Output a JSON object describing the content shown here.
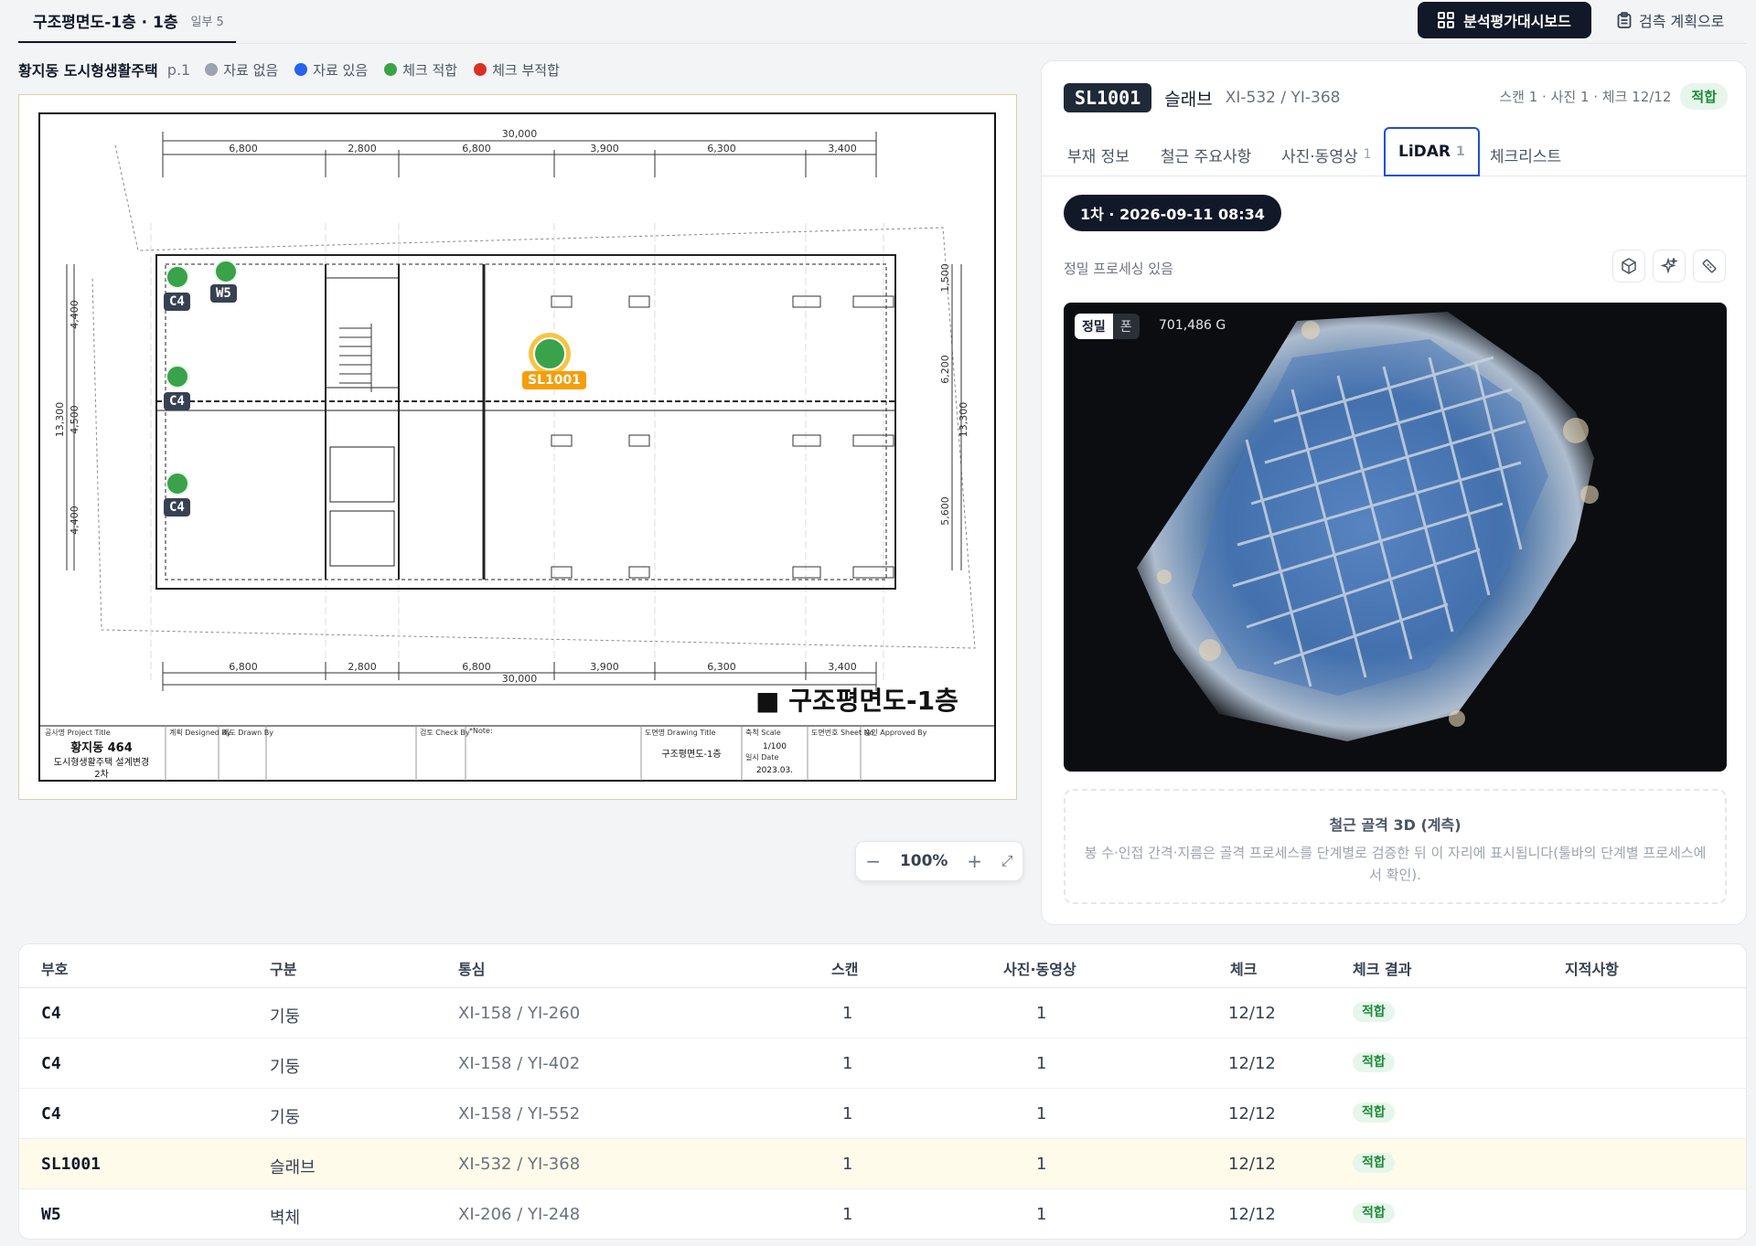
{
  "top": {
    "tab_title": "구조평면도-1층 · 1층",
    "tab_sub": "일부 5",
    "dashboard_label": "분석평가대시보드",
    "plan_label": "검측 계획으로"
  },
  "legend": {
    "project": "황지동 도시형생활주택",
    "page": "p.1",
    "items": [
      {
        "label": "자료 없음",
        "color": "#9ca3af"
      },
      {
        "label": "자료 있음",
        "color": "#2563eb"
      },
      {
        "label": "체크 적합",
        "color": "#3aa24a"
      },
      {
        "label": "체크 부적합",
        "color": "#d93025"
      }
    ]
  },
  "drawing": {
    "title": "■ 구조평면도-1층",
    "dims_top": [
      "6,800",
      "2,800",
      "6,800",
      "3,900",
      "6,300",
      "3,400"
    ],
    "dim_total": "30,000",
    "dims_left": [
      "4,400",
      "4,500",
      "4,400"
    ],
    "dim_left_total": "13,300",
    "dims_right": [
      "1,500",
      "6,200",
      "5,600"
    ],
    "dim_right_total": "13,300",
    "markers": [
      {
        "label": "C4"
      },
      {
        "label": "W5"
      },
      {
        "label": "C4"
      },
      {
        "label": "C4"
      },
      {
        "label": "SL1001"
      }
    ],
    "title_block": {
      "project_title_label": "공사명 Project Title",
      "project_name": "황지동 464",
      "project_sub": "도시형생활주택 설계변경",
      "project_rev": "2차",
      "designed_by": "계획 Designed By",
      "drawn_by": "제도 Drawn By",
      "check_by": "검토 Check By",
      "note": "*Note:",
      "drawing_title_label": "도면명 Drawing Title",
      "drawing_title": "구조평면도-1층",
      "scale_label": "축척 Scale",
      "scale": "1/100",
      "date_label": "일시 Date",
      "date": "2023.03.",
      "sheet_label": "도면번호 Sheet No.",
      "approved_label": "승인 Approved By"
    },
    "zoom": "100%"
  },
  "detail": {
    "code": "SL1001",
    "type": "슬래브",
    "grid": "XI-532 / YI-368",
    "meta": "스캔 1 · 사진 1 · 체크 12/12",
    "status": "적합",
    "tabs": [
      {
        "label": "부재 정보",
        "count": ""
      },
      {
        "label": "철근 주요사항",
        "count": ""
      },
      {
        "label": "사진·동영상",
        "count": "1"
      },
      {
        "label": "LiDAR",
        "count": "1"
      },
      {
        "label": "체크리스트",
        "count": ""
      }
    ],
    "scan_pill": "1차 · 2026-09-11 08:34",
    "processing": "정밀 프로세싱 있음",
    "viewer_toggle": [
      "정밀",
      "폰"
    ],
    "point_count": "701,486 G",
    "note_title": "철근 골격 3D (계측)",
    "note_body": "봉 수·인접 간격·지름은 골격 프로세스를 단계별로 검증한 뒤 이 자리에 표시됩니다(툴바의 단계별 프로세스에서 확인)."
  },
  "table": {
    "headers": [
      "부호",
      "구분",
      "통심",
      "스캔",
      "사진·동영상",
      "체크",
      "체크 결과",
      "지적사항"
    ],
    "rows": [
      {
        "code": "C4",
        "kind": "기둥",
        "grid": "XI-158 / YI-260",
        "scan": "1",
        "photo": "1",
        "check": "12/12",
        "result": "적합",
        "issue": ""
      },
      {
        "code": "C4",
        "kind": "기둥",
        "grid": "XI-158 / YI-402",
        "scan": "1",
        "photo": "1",
        "check": "12/12",
        "result": "적합",
        "issue": ""
      },
      {
        "code": "C4",
        "kind": "기둥",
        "grid": "XI-158 / YI-552",
        "scan": "1",
        "photo": "1",
        "check": "12/12",
        "result": "적합",
        "issue": ""
      },
      {
        "code": "SL1001",
        "kind": "슬래브",
        "grid": "XI-532 / YI-368",
        "scan": "1",
        "photo": "1",
        "check": "12/12",
        "result": "적합",
        "issue": ""
      },
      {
        "code": "W5",
        "kind": "벽체",
        "grid": "XI-206 / YI-248",
        "scan": "1",
        "photo": "1",
        "check": "12/12",
        "result": "적합",
        "issue": ""
      }
    ]
  },
  "colors": {
    "accent": "#111827",
    "ok": "#1f8a3a",
    "selected": "#f59e0b",
    "active_tab_border": "#1d4ed8"
  }
}
